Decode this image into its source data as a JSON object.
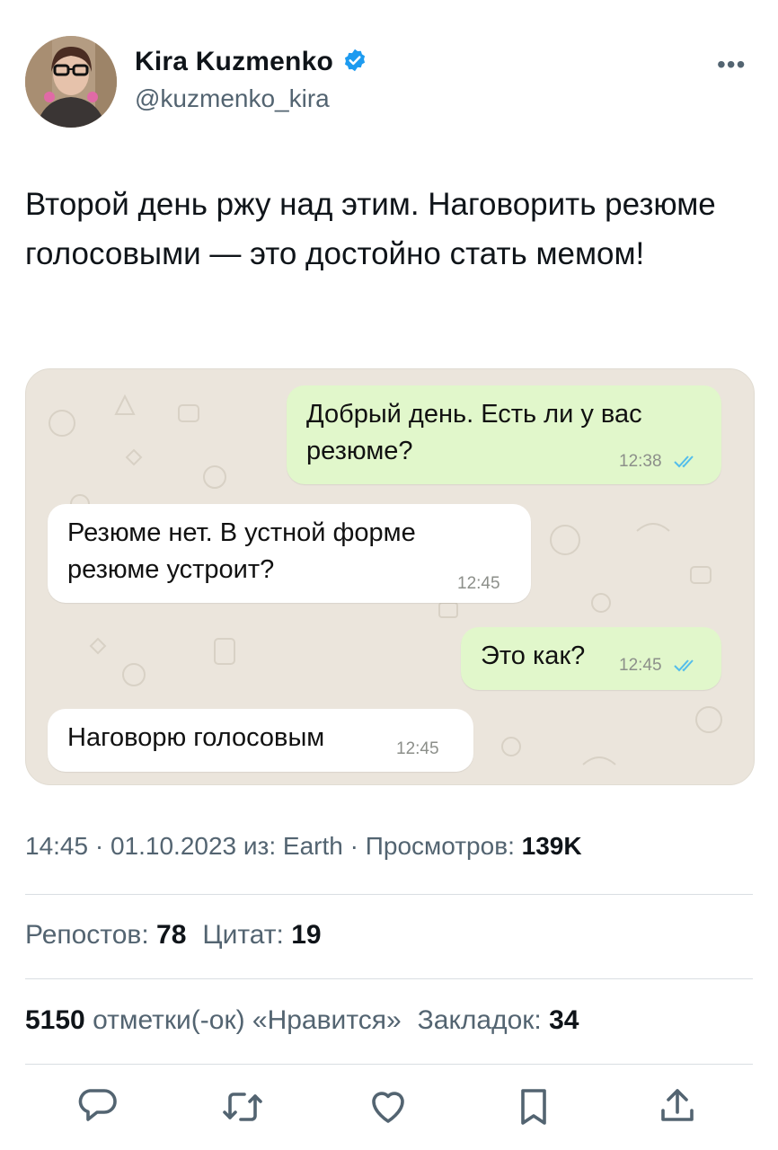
{
  "author": {
    "name": "Kira Kuzmenko",
    "handle": "@kuzmenko_kira",
    "verified_icon": "verified-badge-icon",
    "verified_color": "#1d9bf0"
  },
  "more_label": "•••",
  "tweet": {
    "text": "Второй день ржу над этим. Наговорить резюме голосовыми — это достойно стать мемом!"
  },
  "chat": {
    "messages": [
      {
        "direction": "out",
        "lines": [
          "Добрый день. Есть ли у вас",
          "резюме?"
        ],
        "time": "12:38",
        "read": true
      },
      {
        "direction": "in",
        "lines": [
          "Резюме нет. В устной форме",
          "резюме устроит?"
        ],
        "time": "12:45"
      },
      {
        "direction": "out",
        "lines": [
          "Это как?"
        ],
        "time": "12:45",
        "read": true
      },
      {
        "direction": "in",
        "lines": [
          "Наговорю голосовым"
        ],
        "time": "12:45"
      }
    ]
  },
  "meta": {
    "time": "14:45",
    "sep1": " · ",
    "date": "01.10.2023",
    "source": " из: Earth",
    "sep2": " · ",
    "views_label": "Просмотров: ",
    "views_value": "139K"
  },
  "stats": {
    "reposts_label": "Репостов: ",
    "reposts_value": "78",
    "quotes_label": "Цитат: ",
    "quotes_value": "19",
    "likes_value": "5150",
    "likes_label": " отметки(-ок) «Нравится»",
    "bookmarks_label": "Закладок: ",
    "bookmarks_value": "34"
  },
  "actions": [
    "reply-icon",
    "retweet-icon",
    "like-icon",
    "bookmark-icon",
    "share-icon"
  ],
  "colors": {
    "secondary_text": "#536471",
    "outgoing_bubble": "#e1f7cb",
    "read_ticks": "#53bdeb"
  }
}
